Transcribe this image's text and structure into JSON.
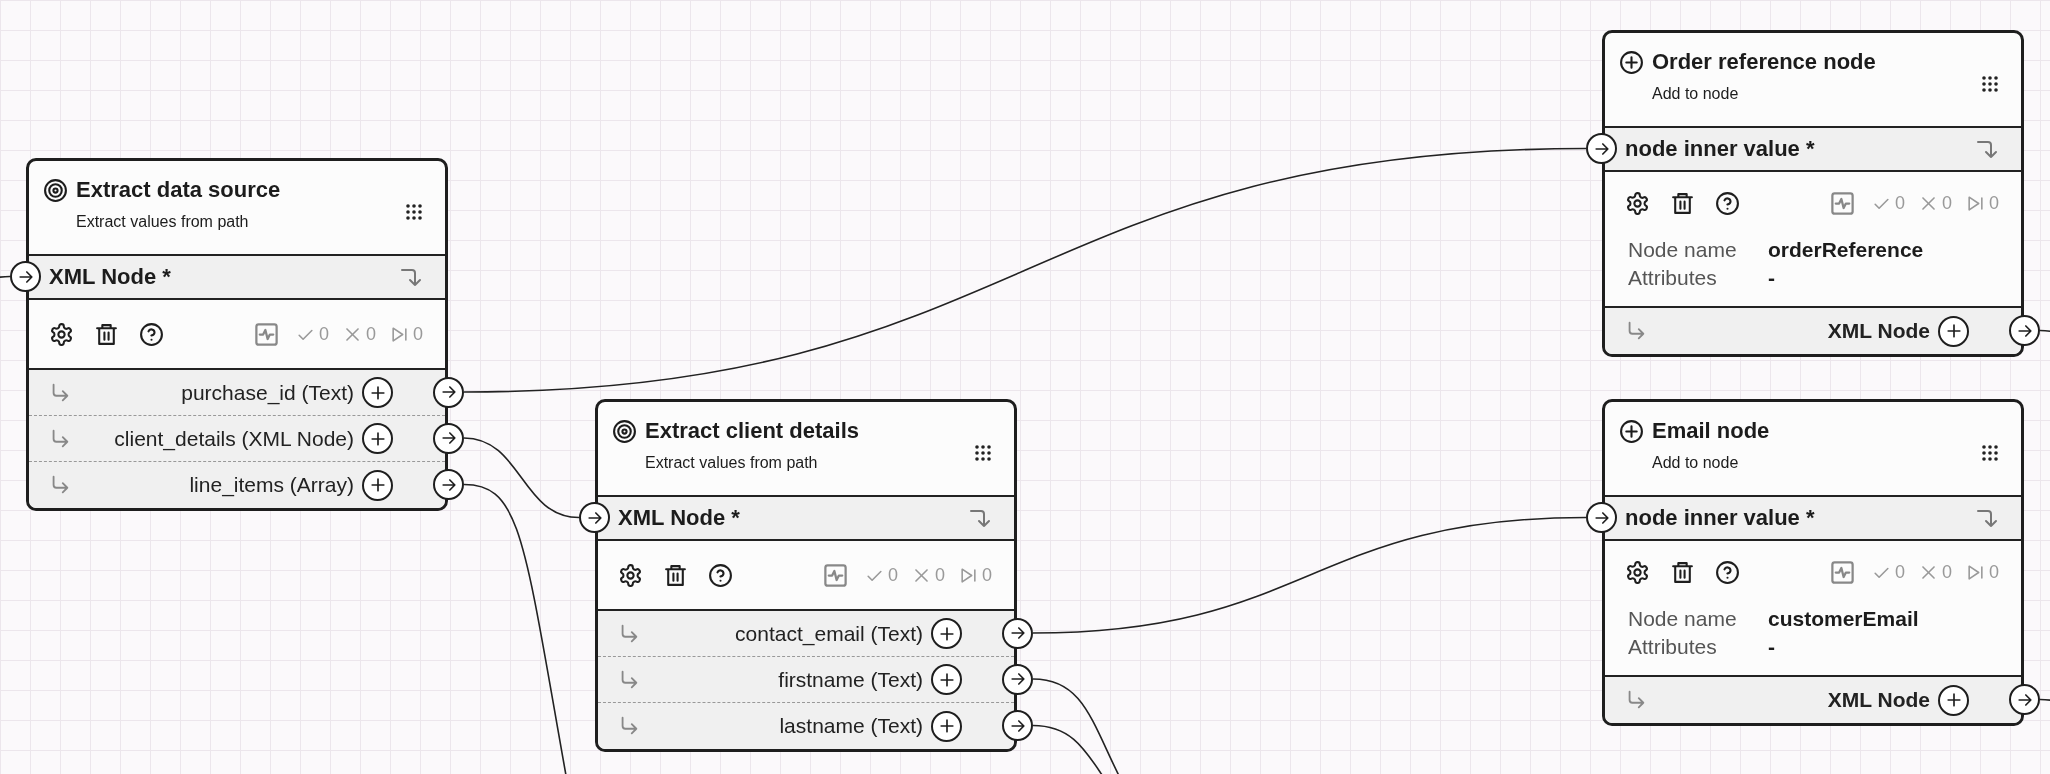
{
  "nodes": [
    {
      "kind": "extract",
      "title": "Extract data source",
      "subtitle": "Extract values from path",
      "input": "XML Node *",
      "stats": [
        "0",
        "0",
        "0"
      ],
      "outputs": [
        "purchase_id (Text)",
        "client_details (XML Node)",
        "line_items (Array)"
      ]
    },
    {
      "kind": "extract",
      "title": "Extract client details",
      "subtitle": "Extract values from path",
      "input": "XML Node *",
      "stats": [
        "0",
        "0",
        "0"
      ],
      "outputs": [
        "contact_email (Text)",
        "firstname (Text)",
        "lastname (Text)"
      ]
    },
    {
      "kind": "add",
      "title": "Order reference node",
      "subtitle": "Add to node",
      "input": "node inner value *",
      "stats": [
        "0",
        "0",
        "0"
      ],
      "details": [
        {
          "label": "Node name",
          "value": "orderReference"
        },
        {
          "label": "Attributes",
          "value": "-"
        }
      ],
      "outputs": [
        "XML Node"
      ]
    },
    {
      "kind": "add",
      "title": "Email node",
      "subtitle": "Add to node",
      "input": "node inner value *",
      "stats": [
        "0",
        "0",
        "0"
      ],
      "details": [
        {
          "label": "Node name",
          "value": "customerEmail"
        },
        {
          "label": "Attributes",
          "value": "-"
        }
      ],
      "outputs": [
        "XML Node"
      ]
    }
  ]
}
